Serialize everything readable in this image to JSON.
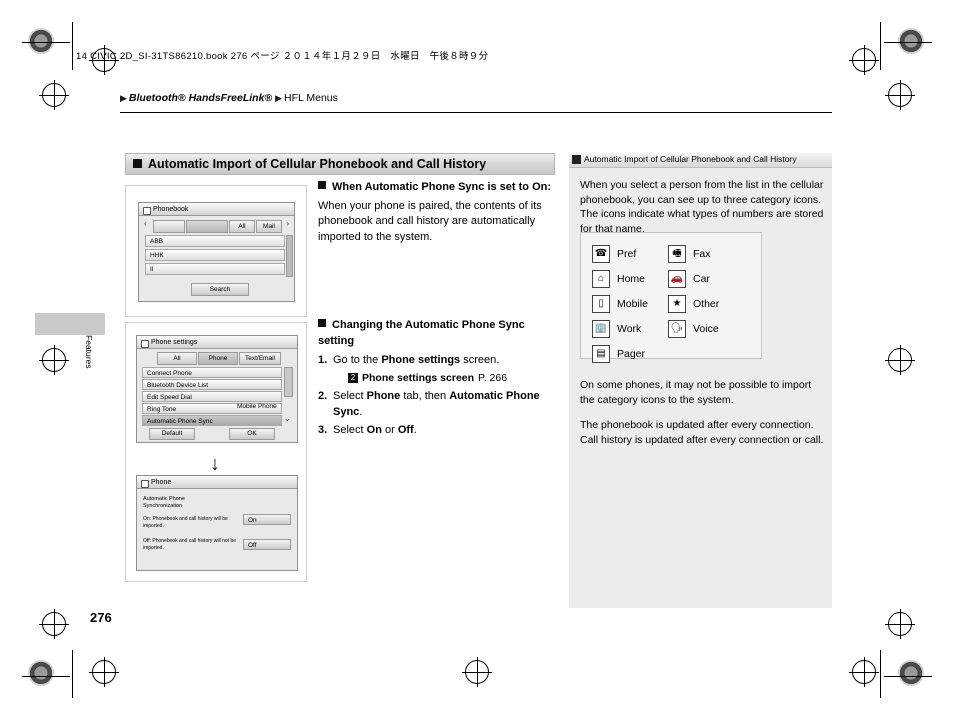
{
  "file_header": "14 CIVIC 2D_SI-31TS86210.book   276 ページ   ２０１４年１月２９日　水曜日　午後８時９分",
  "breadcrumb": {
    "tri1": "u25B6",
    "b1": "Bluetooth® HandsFreeLink®",
    "tri2": "u25B6",
    "b2": "HFL Menus"
  },
  "section_title": "Automatic Import of Cellular Phonebook and Call History",
  "page_number": "276",
  "side_tab_label": "Features",
  "middle": {
    "block1_heading": "When Automatic Phone Sync is set to On:",
    "block1_body": "When your phone is paired, the contents of its phonebook and call history are automatically imported to the system.",
    "block2_heading": "Changing the Automatic Phone Sync setting",
    "steps": [
      {
        "n": "1.",
        "pre": "Go to the ",
        "bold": "Phone settings",
        "post": " screen."
      },
      {
        "n": "2.",
        "pre": "Select ",
        "bold": "Phone",
        "post": " tab, then ",
        "bold2": "Automatic Phone Sync",
        "post2": "."
      },
      {
        "n": "3.",
        "pre": "Select ",
        "bold": "On",
        "post": " or ",
        "bold2": "Off",
        "post2": "."
      }
    ],
    "reference": {
      "icon": "2",
      "bold": "Phone settings screen",
      "page": "P. 266"
    }
  },
  "sidebar": {
    "header_title": "Automatic Import of Cellular Phonebook and Call History",
    "para1": "When you select a person from the list in the cellular phonebook, you can see up to three category icons. The icons indicate what types of numbers are stored for that name.",
    "icons": [
      {
        "glyph": "☎",
        "label": "Pref",
        "name": "pref-icon"
      },
      {
        "glyph": "🖷",
        "label": "Fax",
        "name": "fax-icon"
      },
      {
        "glyph": "⌂",
        "label": "Home",
        "name": "home-icon"
      },
      {
        "glyph": "🚗",
        "label": "Car",
        "name": "car-icon"
      },
      {
        "glyph": "▯",
        "label": "Mobile",
        "name": "mobile-icon"
      },
      {
        "glyph": "★",
        "label": "Other",
        "name": "other-icon"
      },
      {
        "glyph": "🏢",
        "label": "Work",
        "name": "work-icon"
      },
      {
        "glyph": "🗣",
        "label": "Voice",
        "name": "voice-icon"
      },
      {
        "glyph": "▤",
        "label": "Pager",
        "name": "pager-icon"
      }
    ],
    "para2": "On some phones, it may not be possible to import the category icons to the system.",
    "para3": "The phonebook is updated after every connection.\nCall history is updated after every connection or call."
  },
  "figures": {
    "fig1": {
      "title": "Phonebook",
      "tabs": [
        "",
        "",
        "All",
        "Mail"
      ],
      "rows": [
        "ABB",
        "HHK",
        "II"
      ],
      "button": "Search"
    },
    "fig2": {
      "title": "Phone settings",
      "tabs": [
        "All",
        "Phone",
        "Text/Email"
      ],
      "rows": [
        "Connect Phone",
        "Bluetooth Device List",
        "Edit Speed Dial",
        "Ring Tone",
        "Automatic Phone Sync"
      ],
      "row_value": "Mobile Phone",
      "btn_left": "Default",
      "btn_right": "OK"
    },
    "fig3": {
      "title": "Phone",
      "heading": "Automatic Phone Synchronization",
      "desc1": "On: Phonebook and call history will be imported.",
      "desc2": "Off: Phonebook and call history will not be imported.",
      "opt1": "On",
      "opt2": "Off"
    }
  }
}
